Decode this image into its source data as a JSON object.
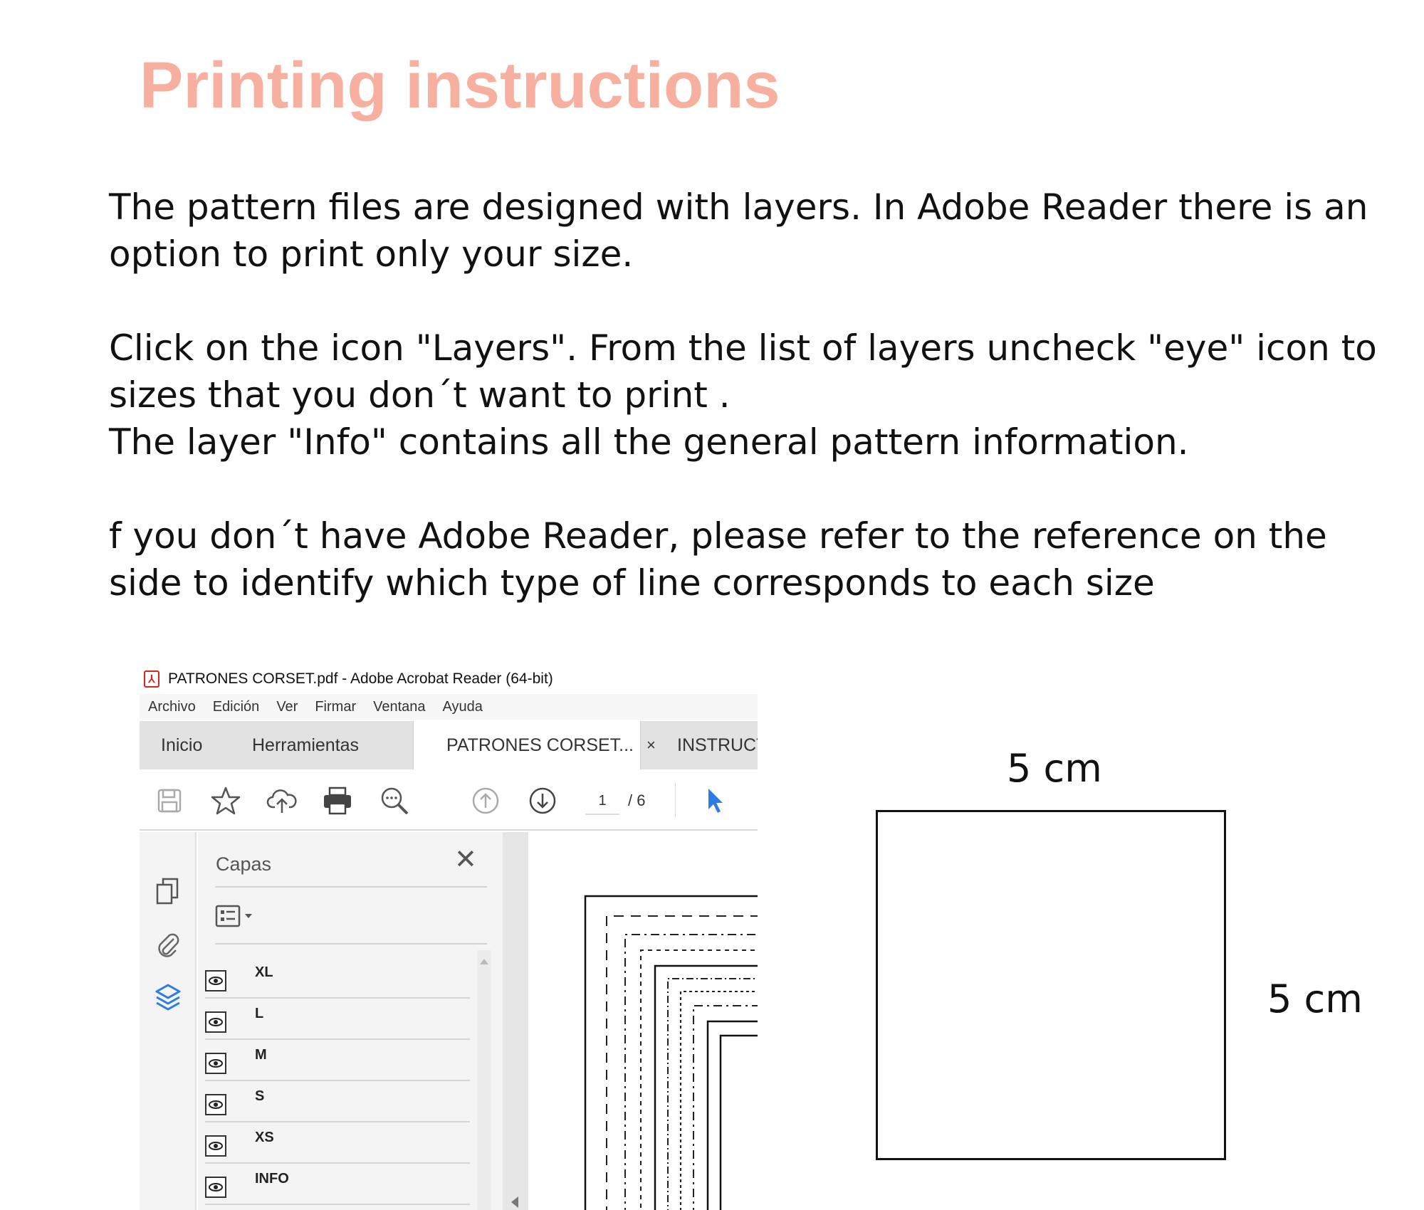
{
  "title": "Printing instructions",
  "paragraphs": {
    "p1": [
      "The pattern files are designed with layers. In Adobe Reader there is an",
      "option to print only your size."
    ],
    "p2": [
      "Click on the icon \"Layers\". From the list of layers uncheck \"eye\" icon to",
      "sizes that you don´t want to print .",
      "The layer \"Info\" contains all the general pattern information."
    ],
    "p3": [
      "f you don´t have Adobe Reader, please refer to the reference on the",
      "side to identify which type of line corresponds to each size"
    ]
  },
  "acrobat": {
    "window_title": "PATRONES CORSET.pdf - Adobe Acrobat Reader (64-bit)",
    "menu": [
      "Archivo",
      "Edición",
      "Ver",
      "Firmar",
      "Ventana",
      "Ayuda"
    ],
    "tabs": {
      "home": "Inicio",
      "tools": "Herramientas",
      "document": "PATRONES CORSET...",
      "document_close": "×",
      "other": "INSTRUCT"
    },
    "toolbar": {
      "icons": [
        "save-icon",
        "star-icon",
        "cloud-upload-icon",
        "print-icon",
        "zoom-icon",
        "page-up-icon",
        "page-down-icon",
        "select-cursor-icon"
      ],
      "current_page": "1",
      "total_pages": "/ 6"
    },
    "rail_icons": [
      "pages-icon",
      "attachment-icon",
      "layers-icon"
    ],
    "layers_panel": {
      "title": "Capas",
      "close": "✕",
      "layers": [
        "XL",
        "L",
        "M",
        "S",
        "XS",
        "INFO"
      ]
    },
    "colors": {
      "accent_blue": "#2d7be5",
      "pdf_red": "#d7261e"
    }
  },
  "reference": {
    "width_label": "5 cm",
    "height_label": "5 cm"
  },
  "colors": {
    "title": "#f7b0a0"
  }
}
